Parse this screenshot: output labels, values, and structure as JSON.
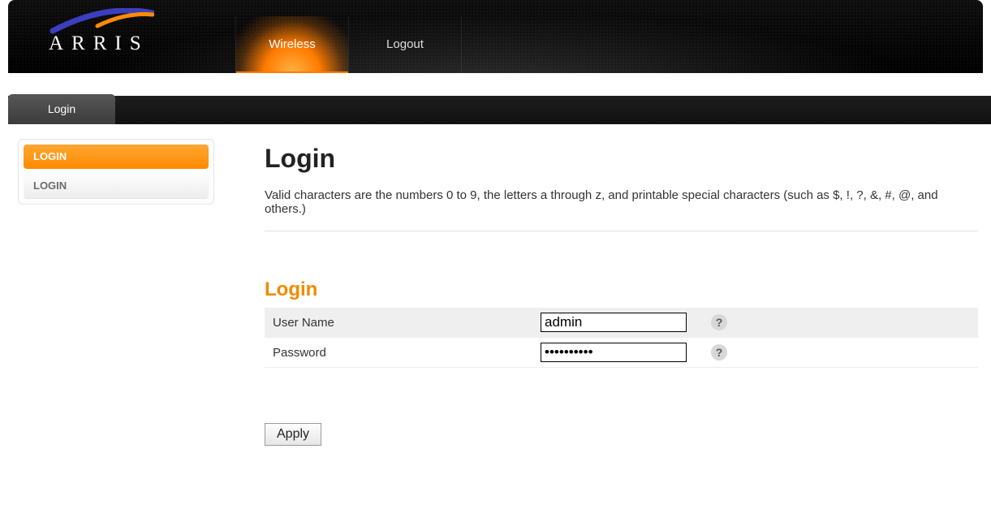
{
  "brand": {
    "name": "ARRIS"
  },
  "nav": {
    "items": [
      {
        "label": "Wireless",
        "active": true
      },
      {
        "label": "Logout",
        "active": false
      }
    ]
  },
  "subnav": {
    "label": "Login"
  },
  "sidebar": {
    "items": [
      {
        "label": "LOGIN",
        "active": true
      },
      {
        "label": "LOGIN",
        "active": false
      }
    ]
  },
  "page": {
    "title": "Login",
    "description": "Valid characters are the numbers 0 to 9, the letters a through z, and printable special characters (such as $, !, ?, &, #, @, and others.)",
    "section_title": "Login",
    "fields": {
      "username": {
        "label": "User Name",
        "value": "admin"
      },
      "password": {
        "label": "Password",
        "value": "••••••••••"
      }
    },
    "help_glyph": "?",
    "apply_label": "Apply"
  }
}
